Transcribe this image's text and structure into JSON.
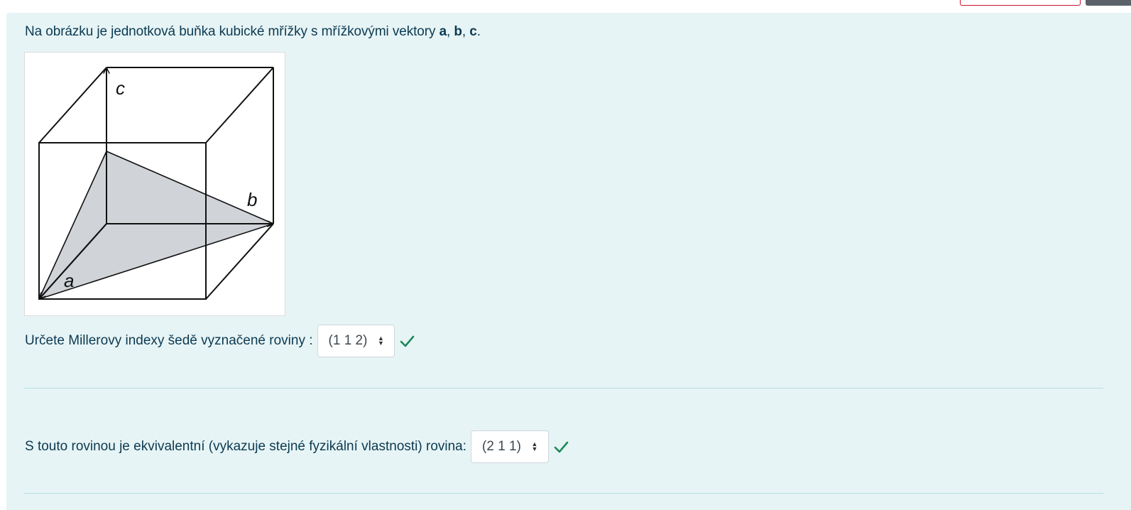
{
  "question": {
    "intro_text": "Na obrázku je jednotková buňka kubické mřížky s mřížkovými vektory ",
    "intro_vectors": [
      "a",
      "b",
      "c"
    ],
    "intro_separator_1": ", ",
    "intro_separator_2": ", ",
    "intro_end": ".",
    "figure": {
      "label_a": "a",
      "label_b": "b",
      "label_c": "c"
    },
    "part1": {
      "label": "Určete Millerovy indexy šedě vyznačené roviny :",
      "selected": "(1 1 2)",
      "status": "correct"
    },
    "part2": {
      "label": "S touto rovinou je ekvivalentní (vykazuje stejné fyzikální vlastnosti) rovina:",
      "selected": "(2 1 1)",
      "status": "correct"
    }
  },
  "colors": {
    "background": "#e7f4f5",
    "text": "#0b3a52",
    "check": "#1a8a5a",
    "plane_fill": "#d0d3d8"
  },
  "icons": {
    "check": "check-icon",
    "caret": "sort-caret-icon"
  }
}
